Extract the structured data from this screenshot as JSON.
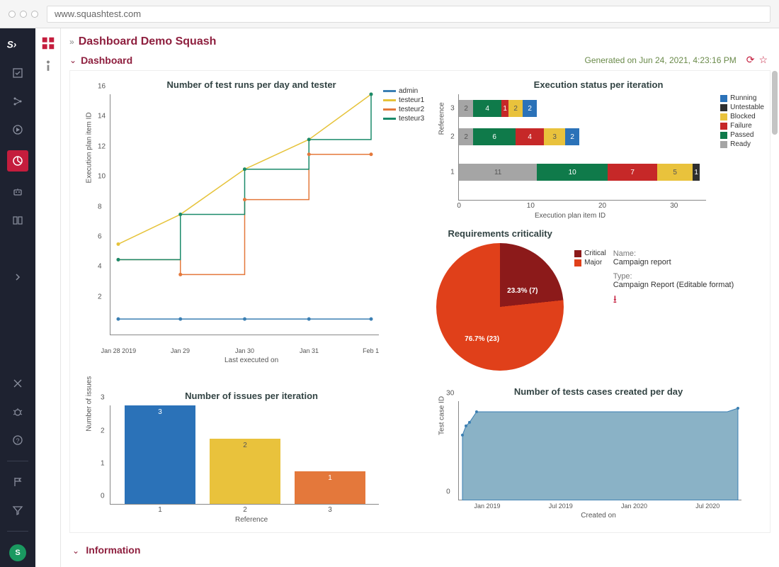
{
  "browser": {
    "url": "www.squashtest.com"
  },
  "page_title": "Dashboard Demo Squash",
  "section_dashboard": "Dashboard",
  "section_info": "Information",
  "generated_text": "Generated on Jun 24, 2021, 4:23:16 PM",
  "avatar_initial": "S",
  "report_meta": {
    "name_label": "Name:",
    "name_value": "Campaign report",
    "type_label": "Type:",
    "type_value": "Campaign Report (Editable format)"
  },
  "colors": {
    "admin": "#3b7fb3",
    "testeur1": "#e6c33a",
    "testeur2": "#e4783b",
    "testeur3": "#1a8a6a",
    "running": "#2b72b8",
    "untestable": "#2f2f2f",
    "blocked": "#e9c23c",
    "failure": "#c62828",
    "passed": "#0f7a4a",
    "ready": "#a5a5a5",
    "critical": "#8c1a1a",
    "major": "#e0401a",
    "bar1": "#2b72b8",
    "bar2": "#e9c23c",
    "bar3": "#e4783b",
    "area": "#8ab2c6"
  },
  "chart_data": [
    {
      "id": "runs_per_day",
      "type": "line",
      "title": "Number of test runs per day and tester",
      "xlabel": "Last executed on",
      "ylabel": "Execution plan item ID",
      "x": [
        "Jan 28 2019",
        "Jan 29",
        "Jan 30",
        "Jan 31",
        "Feb 1"
      ],
      "yticks": [
        2,
        4,
        6,
        8,
        10,
        12,
        14,
        16
      ],
      "series": [
        {
          "name": "admin",
          "values": [
            1,
            1,
            1,
            1,
            1
          ]
        },
        {
          "name": "testeur1",
          "values": [
            6,
            8,
            11,
            13,
            16
          ]
        },
        {
          "name": "testeur2",
          "values": [
            5,
            4,
            9,
            12,
            12
          ]
        },
        {
          "name": "testeur3",
          "values": [
            5,
            8,
            11,
            13,
            16
          ]
        }
      ]
    },
    {
      "id": "exec_status",
      "type": "bar",
      "orientation": "horizontal-stacked",
      "title": "Execution status per iteration",
      "xlabel": "Execution plan item ID",
      "ylabel": "Reference",
      "xticks": [
        0,
        10,
        20,
        30
      ],
      "y_categories": [
        "1",
        "2",
        "3"
      ],
      "legend": [
        "Running",
        "Untestable",
        "Blocked",
        "Failure",
        "Passed",
        "Ready"
      ],
      "stacks": {
        "1": [
          {
            "status": "Ready",
            "v": 11
          },
          {
            "status": "Passed",
            "v": 10
          },
          {
            "status": "Failure",
            "v": 7
          },
          {
            "status": "Blocked",
            "v": 5
          },
          {
            "status": "Untestable",
            "v": 1
          }
        ],
        "2": [
          {
            "status": "Ready",
            "v": 2
          },
          {
            "status": "Passed",
            "v": 6
          },
          {
            "status": "Failure",
            "v": 4
          },
          {
            "status": "Blocked",
            "v": 3
          },
          {
            "status": "Running",
            "v": 2
          }
        ],
        "3": [
          {
            "status": "Ready",
            "v": 2
          },
          {
            "status": "Passed",
            "v": 4
          },
          {
            "status": "Failure",
            "v": 1
          },
          {
            "status": "Blocked",
            "v": 2
          },
          {
            "status": "Running",
            "v": 2
          }
        ]
      }
    },
    {
      "id": "req_criticality",
      "type": "pie",
      "title": "Requirements criticality",
      "slices": [
        {
          "label": "Critical",
          "pct": 23.3,
          "count": 7,
          "display": "23.3% (7)"
        },
        {
          "label": "Major",
          "pct": 76.7,
          "count": 23,
          "display": "76.7% (23)"
        }
      ]
    },
    {
      "id": "issues_per_iter",
      "type": "bar",
      "title": "Number of issues per iteration",
      "xlabel": "Reference",
      "ylabel": "Number of issues",
      "categories": [
        "1",
        "2",
        "3"
      ],
      "values": [
        3,
        2,
        1
      ],
      "yticks": [
        0,
        1,
        2,
        3
      ]
    },
    {
      "id": "tests_created",
      "type": "area",
      "title": "Number of tests cases created per day",
      "xlabel": "Created on",
      "ylabel": "Test case ID",
      "xticks": [
        "Jan 2019",
        "Jul 2019",
        "Jan 2020",
        "Jul 2020"
      ],
      "yticks": [
        0,
        30
      ],
      "points_approx": [
        [
          0,
          20
        ],
        [
          2,
          23
        ],
        [
          4,
          24
        ],
        [
          10,
          28
        ],
        [
          100,
          28
        ],
        [
          100,
          29
        ]
      ]
    }
  ]
}
